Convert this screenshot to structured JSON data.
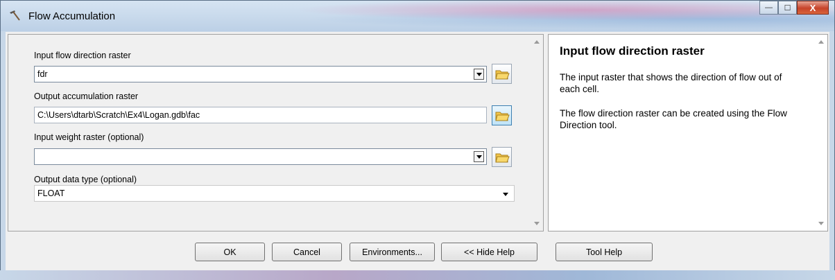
{
  "window": {
    "title": "Flow Accumulation",
    "controls": {
      "minimize": "—",
      "maximize": "☐",
      "close": "X"
    }
  },
  "params": {
    "input_flow_direction": {
      "label": "Input flow direction raster",
      "value": "fdr"
    },
    "output_accumulation": {
      "label": "Output accumulation raster",
      "value": "C:\\Users\\dtarb\\Scratch\\Ex4\\Logan.gdb\\fac"
    },
    "input_weight": {
      "label": "Input weight raster (optional)",
      "value": ""
    },
    "output_data_type": {
      "label": "Output data type (optional)",
      "value": "FLOAT"
    }
  },
  "help": {
    "title": "Input flow direction raster",
    "paragraphs": [
      "The input raster that shows the direction of flow out of each cell.",
      "The flow direction raster can be created using the Flow Direction tool."
    ]
  },
  "buttons": {
    "ok": "OK",
    "cancel": "Cancel",
    "environments": "Environments...",
    "hide_help": "<< Hide Help",
    "tool_help": "Tool Help"
  },
  "icons": {
    "app": "hammer-icon",
    "browse": "folder-open-icon"
  }
}
